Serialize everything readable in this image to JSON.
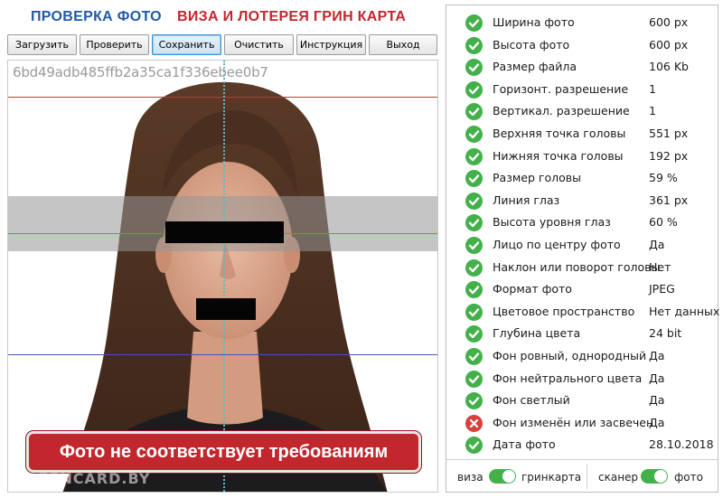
{
  "header": {
    "title_left": "ПРОВЕРКА ФОТО",
    "title_right": "ВИЗА И ЛОТЕРЕЯ ГРИН КАРТА"
  },
  "toolbar": {
    "buttons": [
      {
        "label": "Загрузить"
      },
      {
        "label": "Проверить"
      },
      {
        "label": "Сохранить"
      },
      {
        "label": "Очистить"
      },
      {
        "label": "Инструкция"
      },
      {
        "label": "Выход"
      }
    ]
  },
  "photo": {
    "hash": "6bd49adb485ffb2a35ca1f336ebee0b7",
    "result_banner": "Фото не соответствует требованиям",
    "watermark": "GREENCARD.BY"
  },
  "results": {
    "rows": [
      {
        "label": "Ширина фото",
        "value": "600 px",
        "status": "ok"
      },
      {
        "label": "Высота фото",
        "value": "600 px",
        "status": "ok"
      },
      {
        "label": "Размер файла",
        "value": "106 Kb",
        "status": "ok"
      },
      {
        "label": "Горизонт. разрешение",
        "value": "1",
        "status": "ok"
      },
      {
        "label": "Вертикал. разрешение",
        "value": "1",
        "status": "ok"
      },
      {
        "label": "Верхняя точка головы",
        "value": "551 px",
        "status": "ok"
      },
      {
        "label": "Нижняя точка головы",
        "value": "192 px",
        "status": "ok"
      },
      {
        "label": "Размер головы",
        "value": "59 %",
        "status": "ok"
      },
      {
        "label": "Линия глаз",
        "value": "361 px",
        "status": "ok"
      },
      {
        "label": "Высота уровня глаз",
        "value": "60 %",
        "status": "ok"
      },
      {
        "label": "Лицо по центру фото",
        "value": "Да",
        "status": "ok"
      },
      {
        "label": "Наклон или поворот головы",
        "value": "Нет",
        "status": "ok"
      },
      {
        "label": "Формат фото",
        "value": "JPEG",
        "status": "ok"
      },
      {
        "label": "Цветовое пространство",
        "value": "Нет данных",
        "status": "ok"
      },
      {
        "label": "Глубина цвета",
        "value": "24 bit",
        "status": "ok"
      },
      {
        "label": "Фон ровный, однородный",
        "value": "Да",
        "status": "ok"
      },
      {
        "label": "Фон нейтрального цвета",
        "value": "Да",
        "status": "ok"
      },
      {
        "label": "Фон светлый",
        "value": "Да",
        "status": "ok"
      },
      {
        "label": "Фон изменён или засвечен",
        "value": "Да",
        "status": "fail"
      },
      {
        "label": "Дата фото",
        "value": "28.10.2018",
        "status": "ok"
      }
    ]
  },
  "toggles": {
    "left": {
      "off_label": "виза",
      "on_label": "гринкарта",
      "state": "on"
    },
    "right": {
      "off_label": "сканер",
      "on_label": "фото",
      "state": "on"
    }
  },
  "colors": {
    "title_blue": "#1f5aa6",
    "title_red": "#c3262d",
    "ok_green": "#43b04a",
    "fail_red": "#d9413f",
    "banner_red": "#c1272d"
  }
}
